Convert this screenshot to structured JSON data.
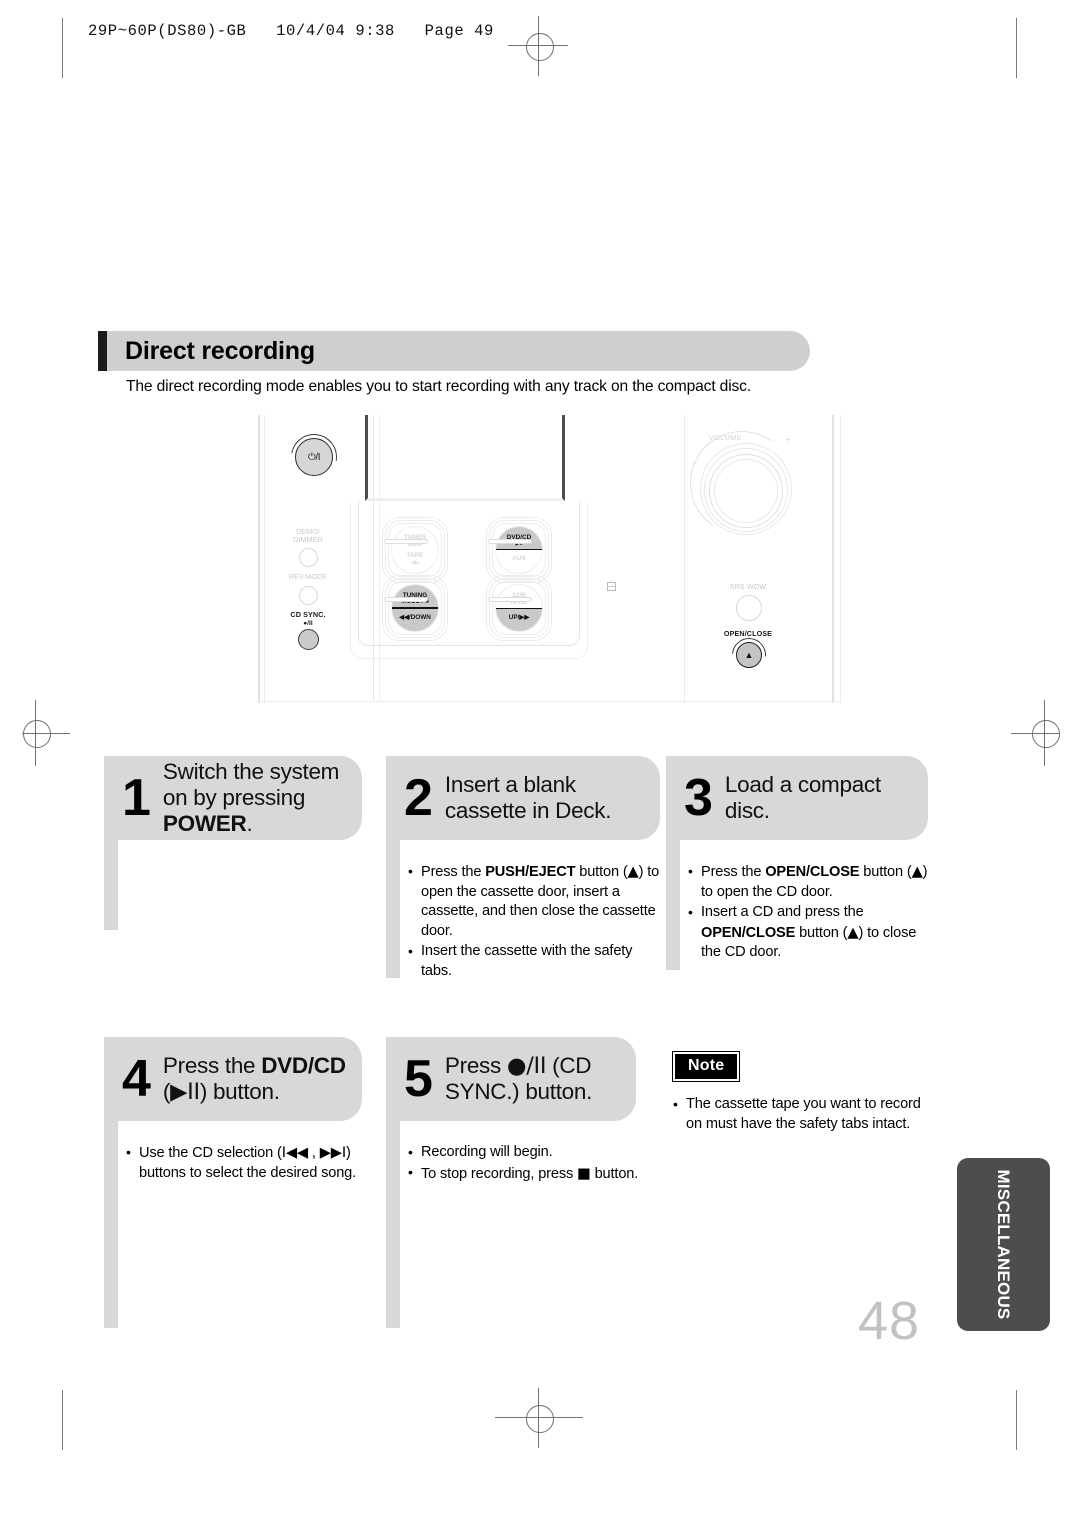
{
  "page": {
    "slug": "29P~60P(DS80)-GB   10/4/04 9:38   Page 49",
    "number": "48",
    "side_tab": "MISCELLANEOUS"
  },
  "section": {
    "title": "Direct recording",
    "intro": "The direct recording mode enables you to start recording with any track on the compact disc."
  },
  "device": {
    "power_label": "⏻/I",
    "left_buttons": [
      {
        "label": "DEMO/\nDIMMER",
        "active": "false"
      },
      {
        "label": "REV.MODE",
        "active": "false"
      },
      {
        "label": "CD SYNC.",
        "sub": "●/II",
        "active": "true"
      }
    ],
    "rockers": [
      {
        "top": "TUNER",
        "top_sub": "BAND",
        "bottom": "TAPE",
        "bottom_sub": "◁I▷",
        "top_on": "false",
        "bottom_on": "false"
      },
      {
        "top": "DVD/CD",
        "top_sub": "▶II",
        "bottom": "AUX",
        "bottom_sub": "",
        "top_on": "true",
        "bottom_on": "false"
      },
      {
        "top": "TUNING",
        "top_sub": "MODE / ■",
        "bottom": "◀◀/DOWN",
        "bottom_sub": "",
        "top_on": "true",
        "bottom_on": "true"
      },
      {
        "top": "S2W",
        "top_sub": "LEVEL",
        "bottom": "UP/▶▶",
        "bottom_sub": "",
        "top_on": "false",
        "bottom_on": "true"
      }
    ],
    "volume_label": "VOLUME",
    "volume_minus": "–",
    "volume_plus": "+",
    "srs_label": "SRS WOW",
    "open_close_label": "OPEN/CLOSE",
    "open_close_icon": "▲"
  },
  "steps": [
    {
      "num": "1",
      "title_html": "Switch the system<br>on by pressing<br><b>POWER</b>.",
      "bullets": []
    },
    {
      "num": "2",
      "title_html": "Insert a blank<br>cassette in Deck.",
      "bullets": [
        "Press the <b>PUSH/EJECT</b> button (<span class=\"gl\">▲</span>) to open the cassette door, insert a cassette, and then close the cassette door.",
        "Insert the cassette with the safety tabs."
      ]
    },
    {
      "num": "3",
      "title_html": "Load a compact<br>disc.",
      "bullets": [
        "Press the <b>OPEN/CLOSE</b> button (<span class=\"gl\">▲</span>) to open the CD door.",
        "Insert a CD and press the <b>OPEN/CLOSE</b> button (<span class=\"gl\">▲</span>) to close the CD door."
      ]
    },
    {
      "num": "4",
      "title_html": "Press the <b>DVD/CD</b><br>(<span class=\"gl\">▶II</span>) button.",
      "bullets": [
        "Use the CD selection (<span class=\"gl\">I◀◀</span> , <span class=\"gl\">▶▶I</span>) buttons to select the desired song."
      ]
    },
    {
      "num": "5",
      "title_html": "Press <span class=\"gl\">●/II</span> (CD<br>SYNC.) button.",
      "bullets": [
        "Recording will begin.",
        "To stop recording, press <span class=\"gl\">■</span> button."
      ]
    }
  ],
  "note": {
    "badge": "Note",
    "bullets": [
      "The cassette tape you want to record on must have the safety tabs intact."
    ]
  }
}
